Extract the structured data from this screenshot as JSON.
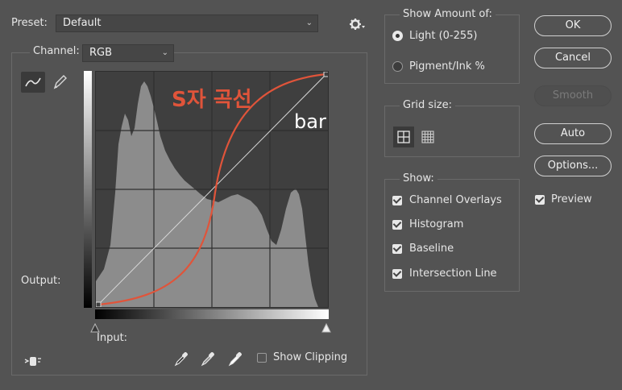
{
  "preset": {
    "label": "Preset:",
    "value": "Default"
  },
  "channel": {
    "label": "Channel:",
    "value": "RGB"
  },
  "graph": {
    "output_label": "Output:",
    "input_label": "Input:",
    "annotation_korean": "S자 곡선",
    "annotation_bar": "bar",
    "curve_color": "#e0543a"
  },
  "show_clipping": {
    "label": "Show Clipping",
    "checked": false
  },
  "show_amount": {
    "title": "Show Amount of:",
    "options": [
      {
        "label": "Light  (0-255)",
        "selected": true
      },
      {
        "label": "Pigment/Ink %",
        "selected": false
      }
    ]
  },
  "grid_size": {
    "title": "Grid size:"
  },
  "show": {
    "title": "Show:",
    "items": [
      {
        "label": "Channel Overlays",
        "checked": true
      },
      {
        "label": "Histogram",
        "checked": true
      },
      {
        "label": "Baseline",
        "checked": true
      },
      {
        "label": "Intersection Line",
        "checked": true
      }
    ]
  },
  "buttons": {
    "ok": "OK",
    "cancel": "Cancel",
    "smooth": "Smooth",
    "auto": "Auto",
    "options": "Options..."
  },
  "preview": {
    "label": "Preview",
    "checked": true
  }
}
